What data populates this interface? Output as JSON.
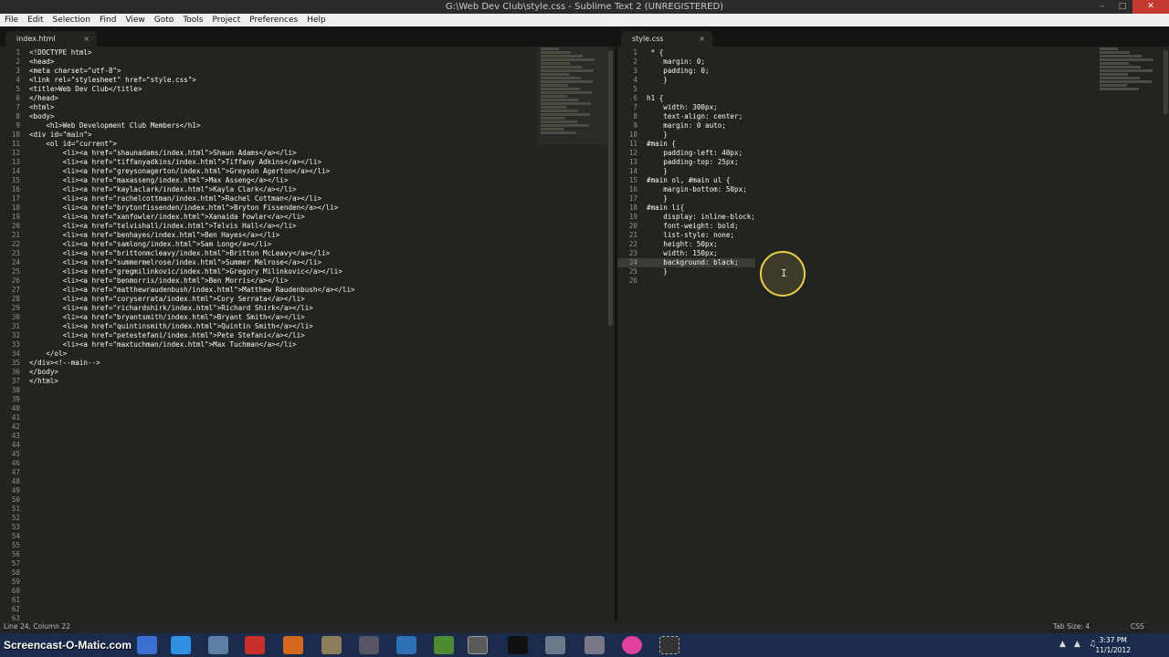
{
  "window": {
    "title": "G:\\Web Dev Club\\style.css - Sublime Text 2 (UNREGISTERED)"
  },
  "menu": [
    "File",
    "Edit",
    "Selection",
    "Find",
    "View",
    "Goto",
    "Tools",
    "Project",
    "Preferences",
    "Help"
  ],
  "left_tab": {
    "label": "index.html",
    "close": "×"
  },
  "right_tab": {
    "label": "style.css",
    "close": "×"
  },
  "left_code": [
    "<!DOCTYPE html>",
    "<head>",
    "<meta charset=\"utf-8\">",
    "<link rel=\"stylesheet\" href=\"style.css\">",
    "<title>Web Dev Club</title>",
    "</head>",
    "<html>",
    "<body>",
    "    <h1>Web Development Club Members</h1>",
    "<div id=\"main\">",
    "    <ol id=\"current\">",
    "        <li><a href=\"shaunadams/index.html\">Shaun Adams</a></li>",
    "        <li><a href=\"tiffanyadkins/index.html\">Tiffany Adkins</a></li>",
    "        <li><a href=\"greysonagerton/index.html\">Greyson Agerton</a></li>",
    "        <li><a href=\"maxasseng/index.html\">Max Asseng</a></li>",
    "        <li><a href=\"kaylaclark/index.html\">Kayla Clark</a></li>",
    "        <li><a href=\"rachelcottman/index.html\">Rachel Cottman</a></li>",
    "        <li><a href=\"brytonfissenden/index.html\">Bryton Fissenden</a></li>",
    "        <li><a href=\"xanfowler/index.html\">Xanaida Fowler</a></li>",
    "        <li><a href=\"telvishall/index.html\">Telvis Hall</a></li>",
    "        <li><a href=\"benhayes/index.html\">Ben Hayes</a></li>",
    "        <li><a href=\"samlong/index.html\">Sam Long</a></li>",
    "        <li><a href=\"brittonmcleavy/index.html\">Britton McLeavy</a></li>",
    "        <li><a href=\"summermelrose/index.html\">Summer Melrose</a></li>",
    "        <li><a href=\"gregmilinkovic/index.html\">Gregory Milinkovic</a></li>",
    "        <li><a href=\"benmorris/index.html\">Ben Morris</a></li>",
    "        <li><a href=\"matthewraudenbush/index.html\">Matthew Raudenbush</a></li>",
    "        <li><a href=\"coryserrata/index.html\">Cory Serrata</a></li>",
    "        <li><a href=\"richardshirk/index.html\">Richard Shirk</a></li>",
    "        <li><a href=\"bryantsmith/index.html\">Bryant Smith</a></li>",
    "        <li><a href=\"quintinsmith/index.html\">Quintin Smith</a></li>",
    "        <li><a href=\"petestefani/index.html\">Pete Stefani</a></li>",
    "        <li><a href=\"maxtuchman/index.html\">Max Tuchman</a></li>",
    "    </ol>",
    "</div><!--main-->",
    "</body>",
    "</html>",
    "",
    "",
    "",
    "",
    "",
    "",
    "",
    "",
    "",
    "",
    "",
    "",
    "",
    "",
    "",
    "",
    "",
    "",
    "",
    "",
    "",
    "",
    "",
    "",
    "",
    "",
    "",
    ""
  ],
  "right_code": [
    " * {",
    "    margin: 0;",
    "    padding: 0;",
    "    }",
    "",
    "h1 {",
    "    width: 300px;",
    "    text-align: center;",
    "    margin: 0 auto;",
    "    }",
    "#main {",
    "    padding-left: 40px;",
    "    padding-top: 25px;",
    "    }",
    "#main ol, #main ul {",
    "    margin-bottom: 50px;",
    "    }",
    "#main li{",
    "    display: inline-block;",
    "    font-weight: bold;",
    "    list-style: none;",
    "    height: 50px;",
    "    width: 150px;",
    "    background: black;",
    "    }",
    ""
  ],
  "status": {
    "position": "Line 24, Column 22",
    "tab_size": "Tab Size: 4",
    "syntax": "CSS"
  },
  "taskbar": {
    "watermark": "Screencast-O-Matic.com",
    "time": "3:37 PM",
    "date": "11/1/2012"
  }
}
